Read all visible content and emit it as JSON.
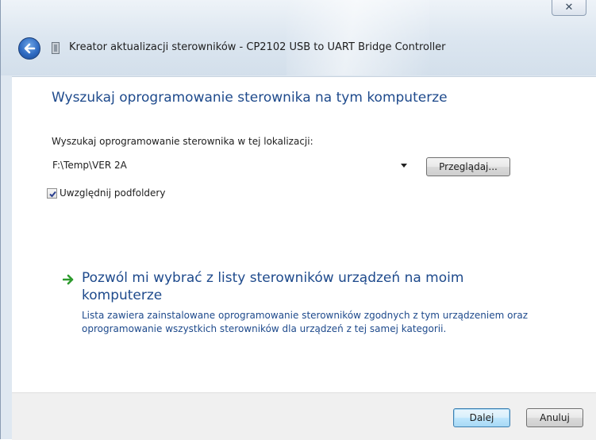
{
  "window": {
    "title": "Kreator aktualizacji sterowników - CP2102 USB to UART Bridge Controller",
    "close_glyph": "✕"
  },
  "icons": {
    "back": "back-arrow-icon",
    "wizard": "hardware-wizard-icon",
    "link": "green-arrow-icon",
    "check": "checkmark-icon"
  },
  "main": {
    "heading": "Wyszukaj oprogramowanie sterownika na tym komputerze",
    "location_label": "Wyszukaj oprogramowanie sterownika w tej lokalizacji:",
    "location_value": "F:\\Temp\\VER 2A",
    "browse_label": "Przeglądaj...",
    "include_subfolders_label": "Uwzględnij podfoldery",
    "include_subfolders_checked": true,
    "pick_link_title": "Pozwól mi wybrać z listy sterowników urządzeń na moim komputerze",
    "pick_link_desc": "Lista zawiera zainstalowane oprogramowanie sterowników zgodnych z tym urządzeniem oraz oprogramowanie wszystkich sterowników dla urządzeń z tej samej kategorii."
  },
  "footer": {
    "next_label": "Dalej",
    "cancel_label": "Anuluj"
  },
  "colors": {
    "heading": "#1e4a8c",
    "link_arrow": "#2e9b2e",
    "accent_button": "#3c7fb1"
  }
}
